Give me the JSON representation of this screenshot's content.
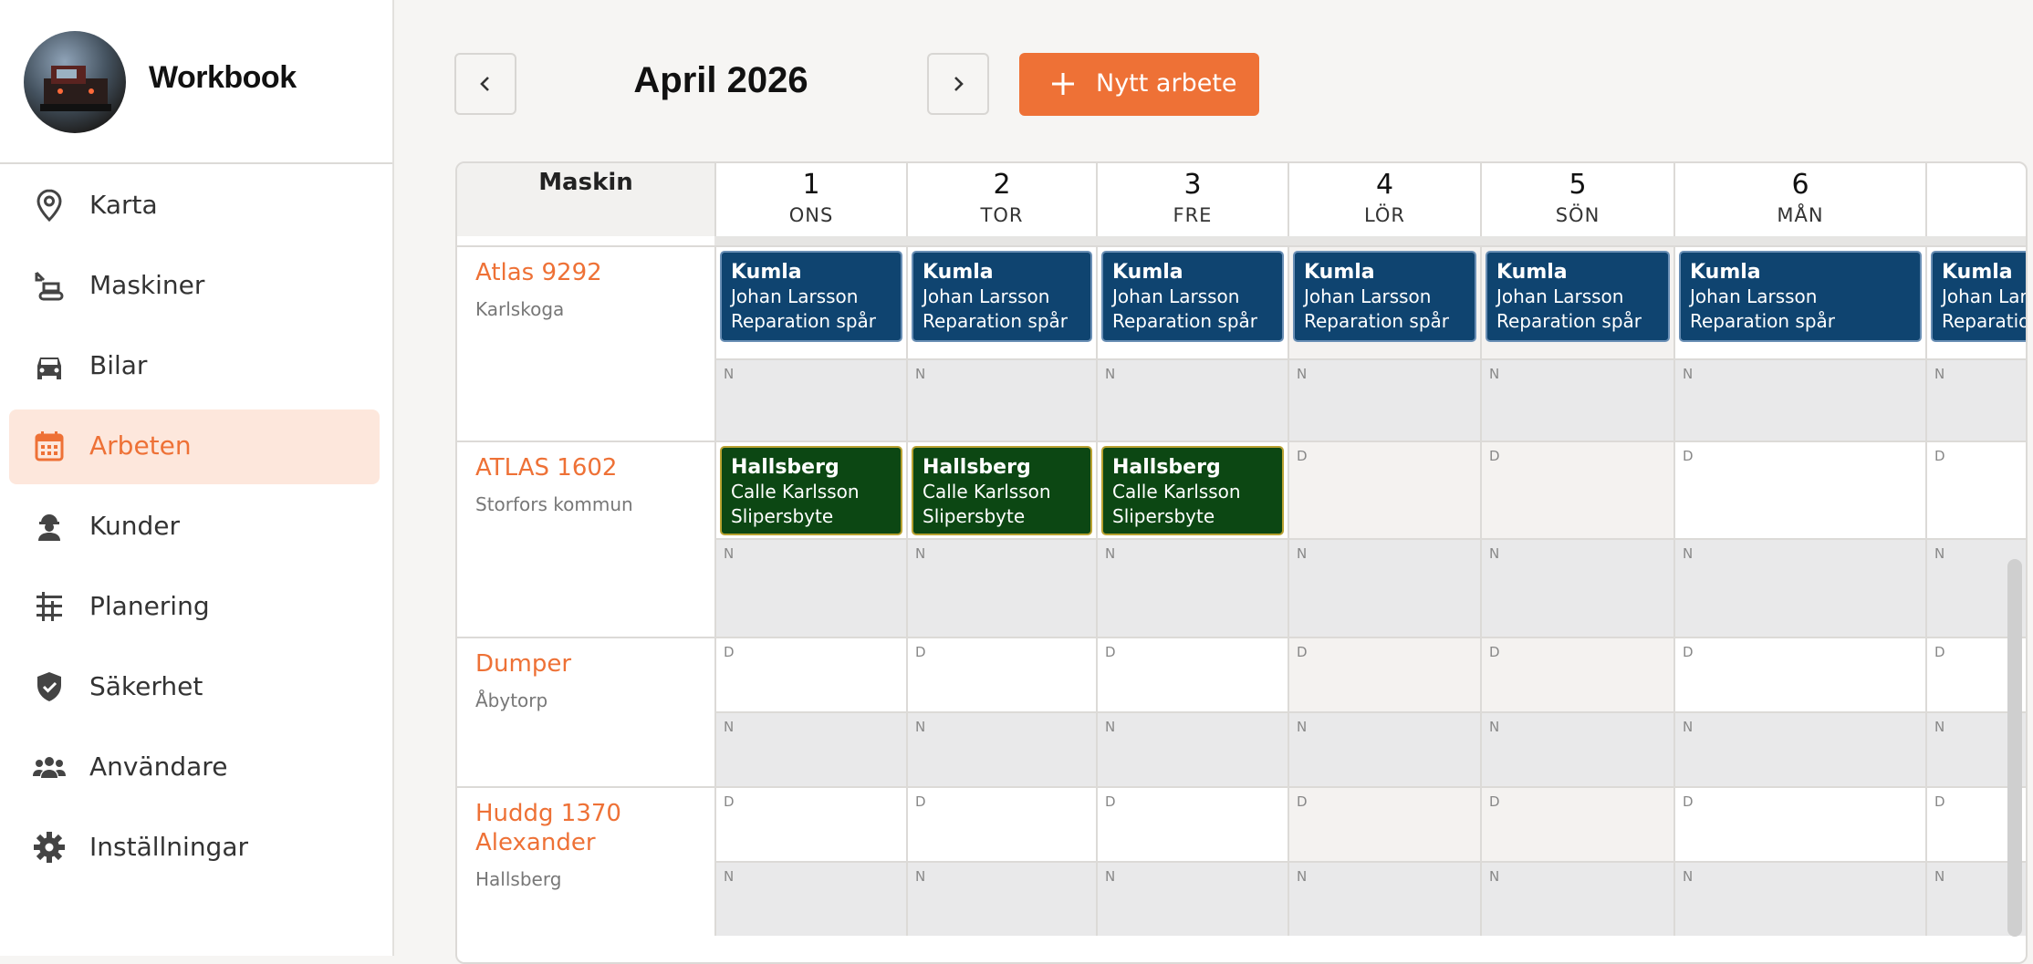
{
  "brand": {
    "name": "Workbook"
  },
  "nav": [
    {
      "label": "Karta",
      "icon": "map-pin-icon",
      "active": false
    },
    {
      "label": "Maskiner",
      "icon": "excavator-icon",
      "active": false
    },
    {
      "label": "Bilar",
      "icon": "car-icon",
      "active": false
    },
    {
      "label": "Arbeten",
      "icon": "calendar-icon",
      "active": true
    },
    {
      "label": "Kunder",
      "icon": "worker-icon",
      "active": false
    },
    {
      "label": "Planering",
      "icon": "planning-icon",
      "active": false
    },
    {
      "label": "Säkerhet",
      "icon": "shield-icon",
      "active": false
    },
    {
      "label": "Användare",
      "icon": "users-icon",
      "active": false
    },
    {
      "label": "Inställningar",
      "icon": "gear-icon",
      "active": false
    }
  ],
  "toolbar": {
    "prev_icon": "chevron-left-icon",
    "next_icon": "chevron-right-icon",
    "month": "April 2026",
    "new_label": "Nytt arbete"
  },
  "grid": {
    "machine_header": "Maskin",
    "days": [
      {
        "num": "1",
        "name": "ONS",
        "weekend": false
      },
      {
        "num": "2",
        "name": "TOR",
        "weekend": false
      },
      {
        "num": "3",
        "name": "FRE",
        "weekend": false
      },
      {
        "num": "4",
        "name": "LÖR",
        "weekend": true
      },
      {
        "num": "5",
        "name": "SÖN",
        "weekend": true
      },
      {
        "num": "6",
        "name": "MÅN",
        "weekend": false
      },
      {
        "num": "",
        "name": "",
        "weekend": false
      }
    ],
    "shift_day": "D",
    "shift_night": "N",
    "machines": [
      {
        "name": "Atlas 9292",
        "location": "Karlskoga",
        "day_jobs": [
          {
            "place": "Kumla",
            "person": "Johan Larsson",
            "task": "Reparation spår",
            "color": "blue"
          },
          {
            "place": "Kumla",
            "person": "Johan Larsson",
            "task": "Reparation spår",
            "color": "blue"
          },
          {
            "place": "Kumla",
            "person": "Johan Larsson",
            "task": "Reparation spår",
            "color": "blue"
          },
          {
            "place": "Kumla",
            "person": "Johan Larsson",
            "task": "Reparation spår",
            "color": "blue"
          },
          {
            "place": "Kumla",
            "person": "Johan Larsson",
            "task": "Reparation spår",
            "color": "blue"
          },
          {
            "place": "Kumla",
            "person": "Johan Larsson",
            "task": "Reparation spår",
            "color": "blue"
          },
          {
            "place": "Kumla",
            "person": "Johan Larsson",
            "task": "Reparation spår",
            "color": "blue"
          }
        ]
      },
      {
        "name": "ATLAS 1602",
        "location": "Storfors kommun",
        "day_jobs": [
          {
            "place": "Hallsberg",
            "person": "Calle Karlsson",
            "task": "Slipersbyte",
            "color": "green"
          },
          {
            "place": "Hallsberg",
            "person": "Calle Karlsson",
            "task": "Slipersbyte",
            "color": "green"
          },
          {
            "place": "Hallsberg",
            "person": "Calle Karlsson",
            "task": "Slipersbyte",
            "color": "green"
          },
          null,
          null,
          null,
          null
        ]
      },
      {
        "name": "Dumper",
        "location": "Åbytorp",
        "day_jobs": [
          null,
          null,
          null,
          null,
          null,
          null,
          null
        ]
      },
      {
        "name": "Huddg 1370 Alexander",
        "location": "Hallsberg",
        "day_jobs": [
          null,
          null,
          null,
          null,
          null,
          null,
          null
        ]
      }
    ]
  },
  "colors": {
    "accent": "#ee7136",
    "job_blue": "#0f4470",
    "job_green": "#0c4713",
    "active_bg": "#fde7dc"
  }
}
